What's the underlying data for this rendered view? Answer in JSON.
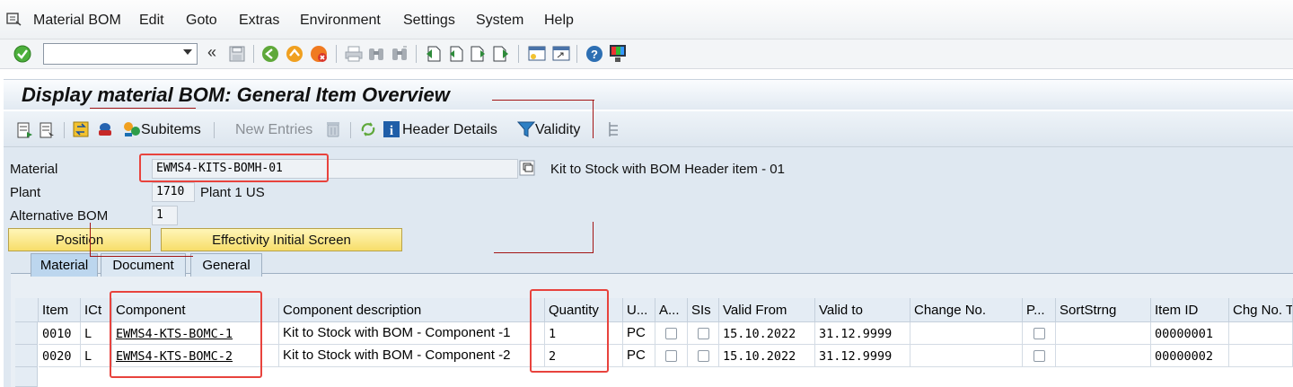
{
  "menu": {
    "items": [
      "Material BOM",
      "Edit",
      "Goto",
      "Extras",
      "Environment",
      "Settings",
      "System",
      "Help"
    ]
  },
  "system_toolbar": {
    "command_field_value": "",
    "back_glyph": "«"
  },
  "title": "Display material BOM: General Item Overview",
  "app_toolbar": {
    "subitems": "Subitems",
    "new_entries": "New Entries",
    "header_details": "Header Details",
    "validity": "Validity"
  },
  "header": {
    "material_label": "Material",
    "material_value": "EWMS4-KITS-BOMH-01",
    "material_desc": "Kit to Stock with BOM Header item - 01",
    "plant_label": "Plant",
    "plant_value": "1710",
    "plant_desc": "Plant 1 US",
    "alt_bom_label": "Alternative BOM",
    "alt_bom_value": "1"
  },
  "buttons": {
    "position": "Position",
    "effectivity": "Effectivity Initial Screen"
  },
  "tabs": [
    "Material",
    "Document",
    "General"
  ],
  "table": {
    "columns": [
      "Item",
      "ICt",
      "Component",
      "Component description",
      "Quantity",
      "U...",
      "A...",
      "SIs",
      "Valid From",
      "Valid to",
      "Change No.",
      "P...",
      "SortStrng",
      "Item ID",
      "Chg No. T"
    ],
    "rows": [
      {
        "item": "0010",
        "ict": "L",
        "component": "EWMS4-KTS-BOMC-1",
        "description": "Kit to Stock with BOM - Component -1",
        "quantity": "1",
        "unit": "PC",
        "valid_from": "15.10.2022",
        "valid_to": "31.12.9999",
        "item_id": "00000001"
      },
      {
        "item": "0020",
        "ict": "L",
        "component": "EWMS4-KTS-BOMC-2",
        "description": "Kit to Stock with BOM - Component -2",
        "quantity": "2",
        "unit": "PC",
        "valid_from": "15.10.2022",
        "valid_to": "31.12.9999",
        "item_id": "00000002"
      }
    ]
  },
  "colors": {
    "highlight": "#e8433d",
    "yellow_button": "#f7de6a",
    "panel": "#dfe8f1"
  }
}
